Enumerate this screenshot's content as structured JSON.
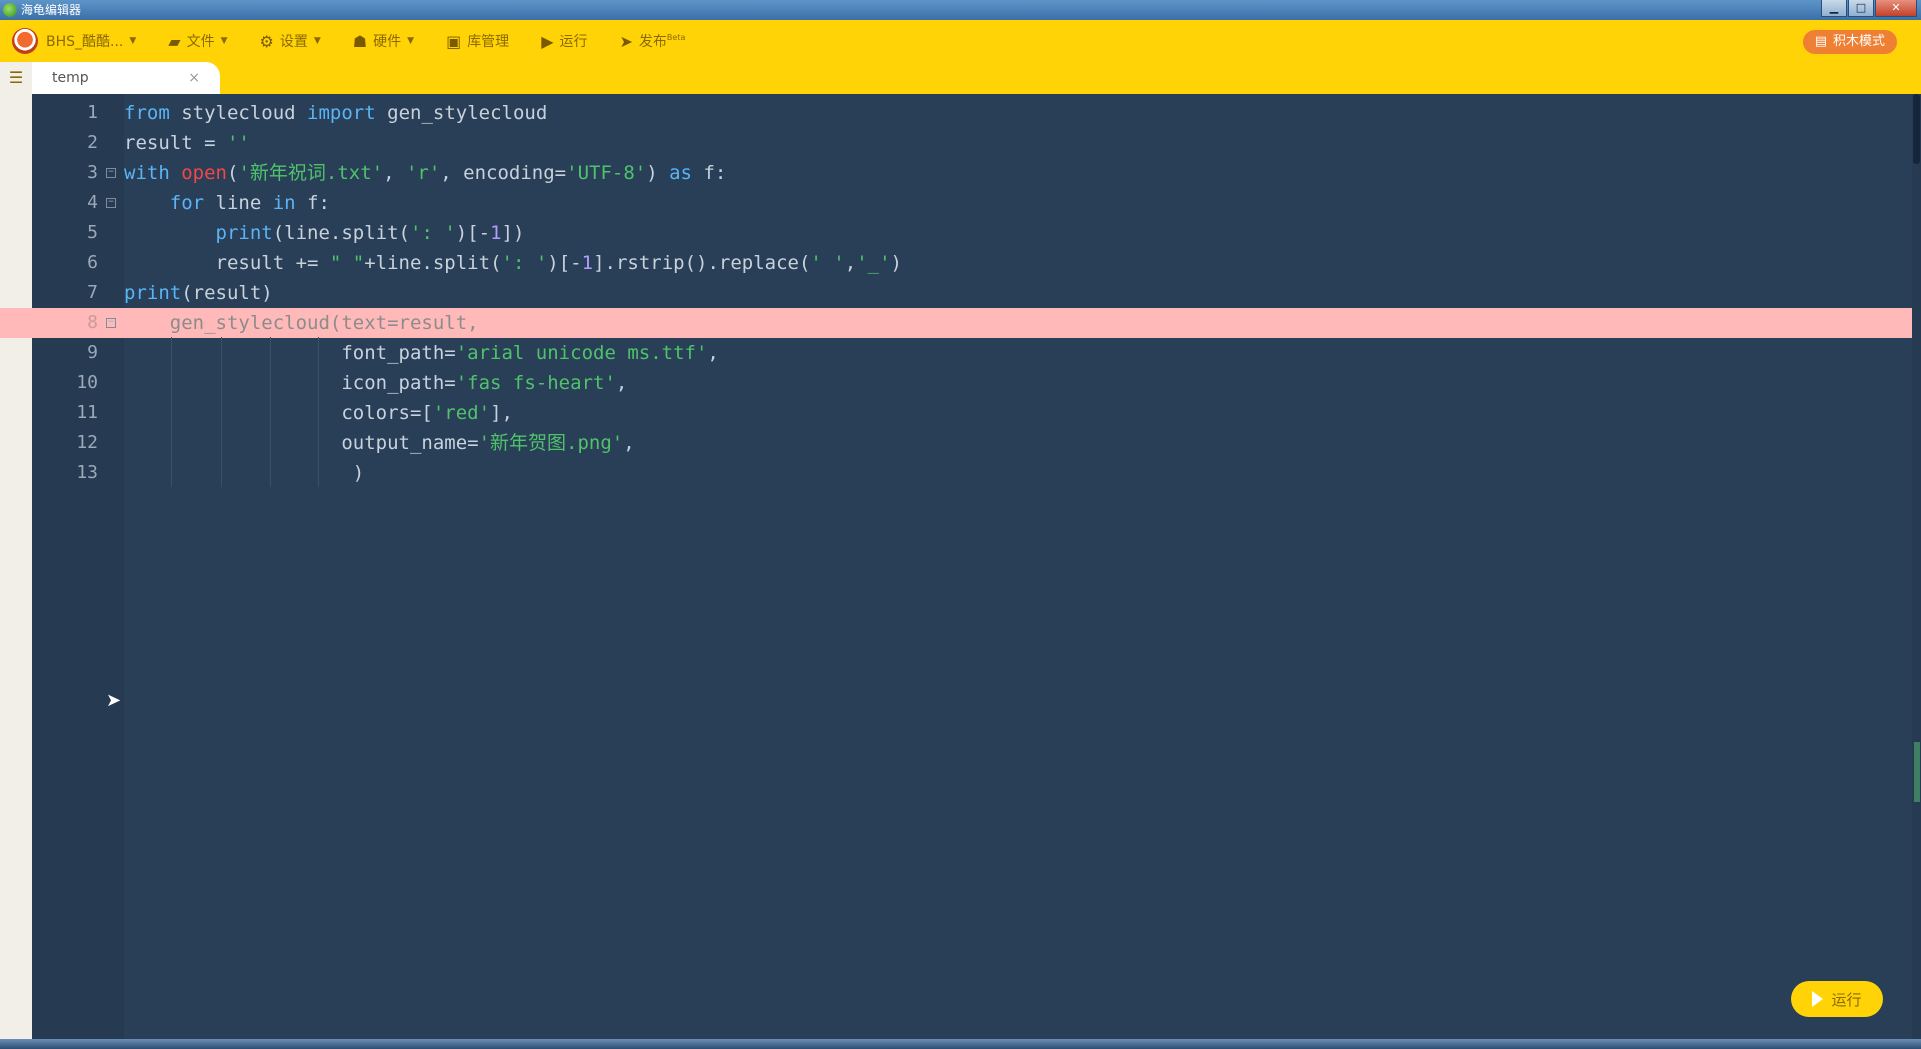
{
  "window": {
    "title": "海龟编辑器",
    "min": "▁",
    "max": "□",
    "close": "✕"
  },
  "toolbar": {
    "account_label": "BHS_酷酷...",
    "file_label": "文件",
    "settings_label": "设置",
    "hardware_label": "硬件",
    "library_label": "库管理",
    "run_label": "运行",
    "publish_label": "发布",
    "publish_beta": "Beta",
    "blocks_mode_label": "积木模式"
  },
  "tabs": [
    {
      "label": "temp",
      "close": "×"
    }
  ],
  "editor": {
    "line_numbers": [
      "1",
      "2",
      "3",
      "4",
      "5",
      "6",
      "7",
      "8",
      "9",
      "10",
      "11",
      "12",
      "13"
    ],
    "lines": [
      "from stylecloud import gen_stylecloud",
      "result = ''",
      "with open('新年祝词.txt', 'r', encoding='UTF-8') as f:",
      "    for line in f:",
      "        print(line.split(': ')[-1])",
      "        result += \" \"+line.split(': ')[-1].rstrip().replace(' ','_')",
      "print(result)",
      "    gen_stylecloud(text=result,",
      "                   font_path='arial unicode ms.ttf',",
      "                   icon_path='fas fs-heart',",
      "                   colors=['red'],",
      "                   output_name='新年贺图.png',",
      "                    )"
    ],
    "error_line": 8
  },
  "run_button": {
    "label": "运行"
  },
  "colors": {
    "toolbar": "#ffd305",
    "editor_bg": "#293e57",
    "keyword": "#5ab4f5",
    "builtin": "#f04848",
    "string": "#4fc36b",
    "error_line_bg": "#ffb9b9"
  }
}
